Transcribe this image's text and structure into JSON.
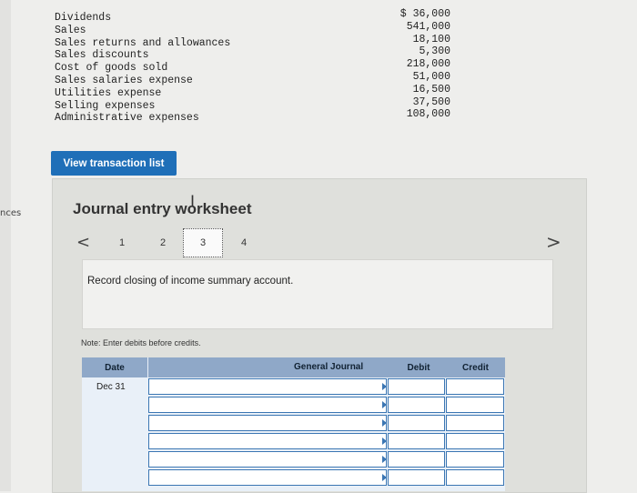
{
  "sidebar": {
    "label": "nces"
  },
  "accounts": [
    {
      "name": "Dividends",
      "value": "$ 36,000"
    },
    {
      "name": "Sales",
      "value": "541,000"
    },
    {
      "name": "Sales returns and allowances",
      "value": "18,100"
    },
    {
      "name": "Sales discounts",
      "value": "5,300"
    },
    {
      "name": "Cost of goods sold",
      "value": "218,000"
    },
    {
      "name": "Sales salaries expense",
      "value": "51,000"
    },
    {
      "name": "Utilities expense",
      "value": "16,500"
    },
    {
      "name": "Selling expenses",
      "value": "37,500"
    },
    {
      "name": "Administrative expenses",
      "value": "108,000"
    }
  ],
  "view_button": "View transaction list",
  "worksheet": {
    "title": "Journal entry worksheet",
    "pages": [
      "1",
      "2",
      "3",
      "4"
    ],
    "active_page": "3",
    "instruction": "Record closing of income summary account.",
    "note": "Note: Enter debits before credits."
  },
  "table": {
    "headers": {
      "date": "Date",
      "general_journal": "General Journal",
      "debit": "Debit",
      "credit": "Credit"
    },
    "rows": [
      {
        "date": "Dec 31"
      },
      {
        "date": ""
      },
      {
        "date": ""
      },
      {
        "date": ""
      },
      {
        "date": ""
      },
      {
        "date": ""
      }
    ]
  }
}
